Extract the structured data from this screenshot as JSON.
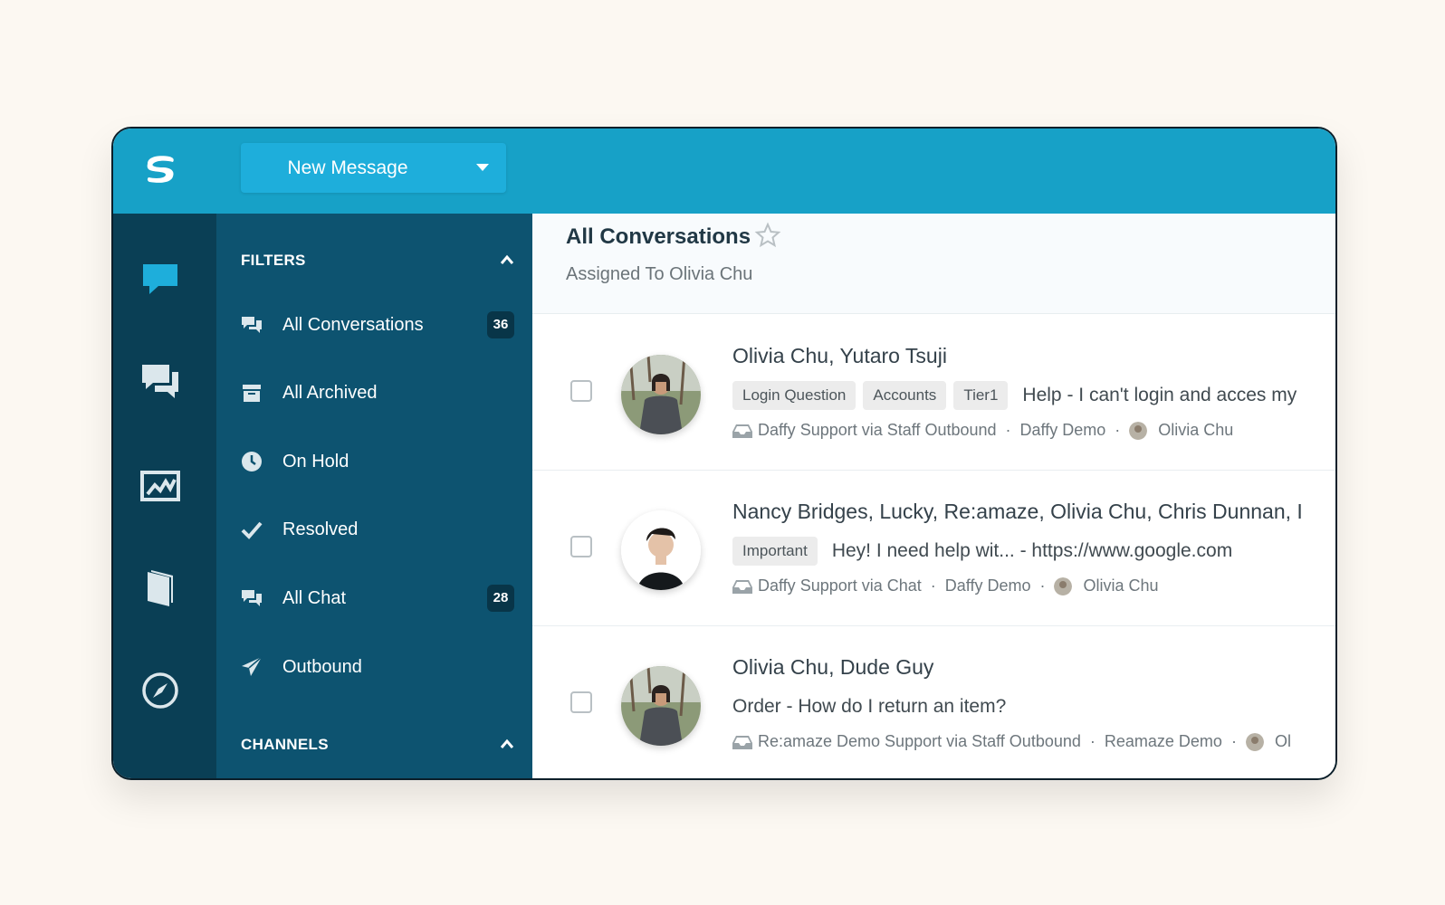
{
  "topbar": {
    "new_message_label": "New Message"
  },
  "rail": {
    "icons": [
      "chat-bubble-icon",
      "conversations-icon",
      "reports-icon",
      "knowledge-book-icon",
      "compass-icon"
    ]
  },
  "sidebar": {
    "filters_heading": "FILTERS",
    "channels_heading": "CHANNELS",
    "items": [
      {
        "label": "All Conversations",
        "count": "36",
        "icon": "chats-icon"
      },
      {
        "label": "All Archived",
        "count": "",
        "icon": "archive-box-icon"
      },
      {
        "label": "On Hold",
        "count": "",
        "icon": "clock-icon"
      },
      {
        "label": "Resolved",
        "count": "",
        "icon": "checkmark-icon"
      },
      {
        "label": "All Chat",
        "count": "28",
        "icon": "chats-icon"
      },
      {
        "label": "Outbound",
        "count": "",
        "icon": "paper-plane-icon"
      }
    ]
  },
  "main": {
    "title": "All Conversations",
    "subtitle": "Assigned To Olivia Chu",
    "conversations": [
      {
        "participants": "Olivia Chu, Yutaro Tsuji",
        "tags": [
          "Login Question",
          "Accounts",
          "Tier1"
        ],
        "snippet": "Help - I can't login and acces my",
        "channel": "Daffy Support via Staff Outbound",
        "brand": "Daffy Demo",
        "assignee": "Olivia Chu"
      },
      {
        "participants": "Nancy Bridges, Lucky, Re:amaze, Olivia Chu, Chris Dunnan, I",
        "tags": [
          "Important"
        ],
        "snippet": "Hey! I need help wit... - https://www.google.com",
        "channel": "Daffy Support via Chat",
        "brand": "Daffy Demo",
        "assignee": "Olivia Chu"
      },
      {
        "participants": "Olivia Chu, Dude Guy",
        "tags": [],
        "snippet": "Order - How do I return an item?",
        "channel": "Re:amaze Demo Support via Staff Outbound",
        "brand": "Reamaze Demo",
        "assignee": "Ol"
      }
    ]
  },
  "colors": {
    "topbar": "#17a1c7",
    "rail": "#0a3f55",
    "sidebar": "#0d5370",
    "accent": "#1eaedb"
  }
}
